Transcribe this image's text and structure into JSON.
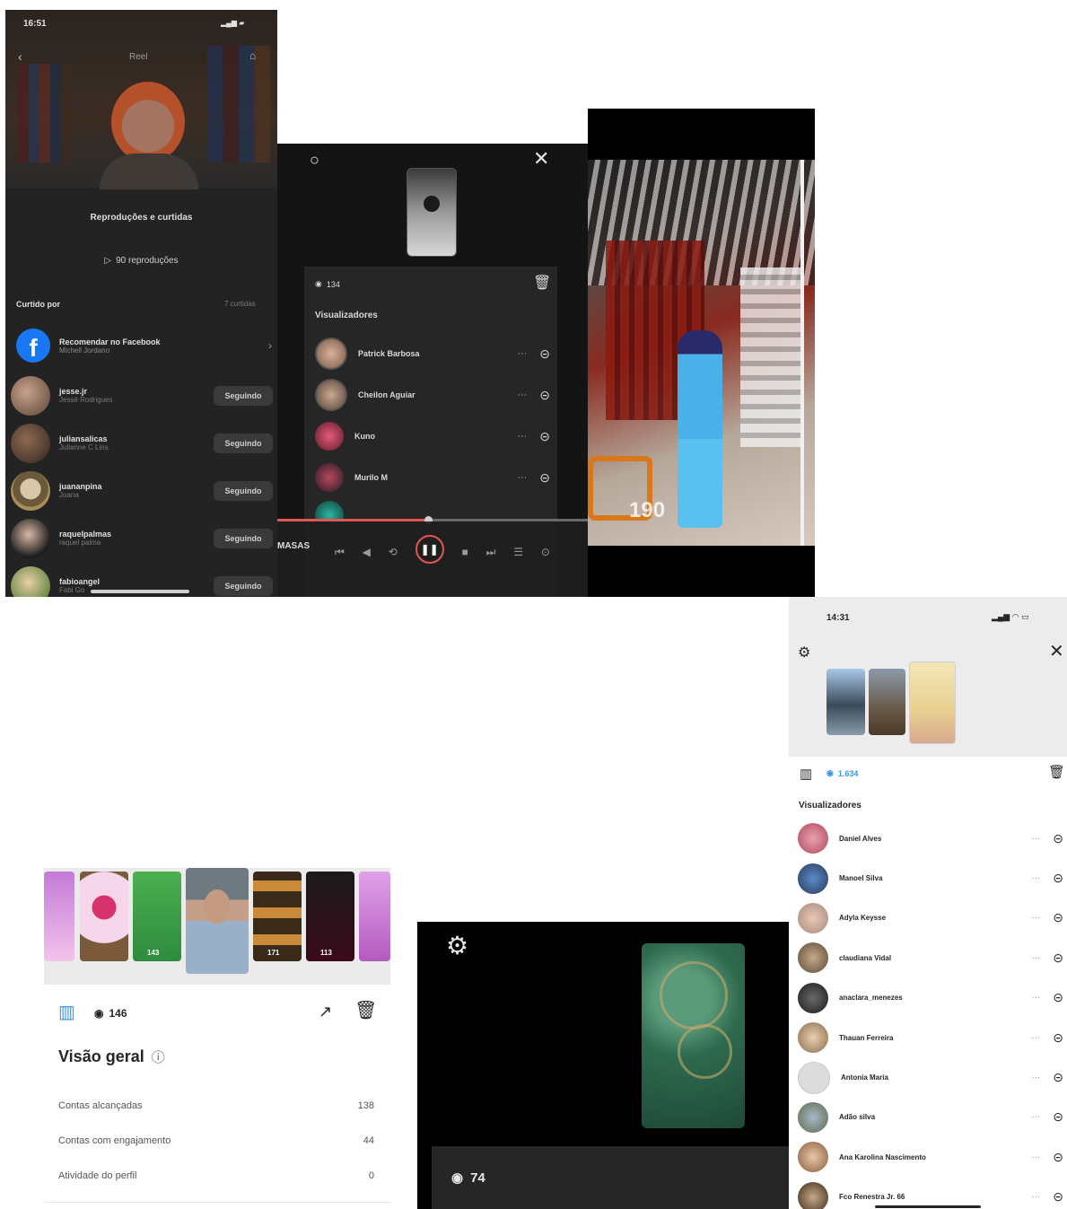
{
  "panel1": {
    "status_time": "16:51",
    "header_title": "Reel",
    "section_title": "Reproduções e curtidas",
    "plays_label": "90 reproduções",
    "liked_by_label": "Curtido por",
    "liked_by_count": "7 curtidas",
    "facebook_title": "Recomendar no Facebook",
    "facebook_sub": "Michell Jordano",
    "follow_label": "Seguindo",
    "users": [
      {
        "name": "jesse.jr",
        "sub": "Jessé Rodrigues"
      },
      {
        "name": "juliansalicas",
        "sub": "Julianne C Lins"
      },
      {
        "name": "juananpina",
        "sub": "Joana"
      },
      {
        "name": "raquelpalmas",
        "sub": "raquel palma"
      },
      {
        "name": "fabioangel",
        "sub": "Fabi Go"
      }
    ]
  },
  "panel2": {
    "views_count": "134",
    "viewers_title": "Visualizadores",
    "viewers": [
      "Patrick Barbosa",
      "Cheilon Aguiar",
      "Kuno",
      "Murilo M"
    ],
    "side_label": "MASAS"
  },
  "panel3": {
    "overlay_number": "190"
  },
  "panel4": {
    "views": "146",
    "overview_title": "Visão geral",
    "stats": [
      {
        "label": "Contas alcançadas",
        "value": "138"
      },
      {
        "label": "Contas com engajamento",
        "value": "44"
      },
      {
        "label": "Atividade do perfil",
        "value": "0"
      }
    ],
    "thumb_counts": [
      "143",
      "171",
      "113"
    ]
  },
  "panel5": {
    "views": "74"
  },
  "panel6": {
    "status_time": "14:31",
    "views": "1.634",
    "viewers_title": "Visualizadores",
    "viewers": [
      "Daniel Alves",
      "Manoel Silva",
      "Adyla Keysse",
      "claudiana Vidal",
      "anaclara_menezes",
      "Thauan Ferreira",
      "Antonia Maria",
      "Adão silva",
      "Ana Karolina Nascimento",
      "Fco Renestra Jr. 66"
    ]
  }
}
